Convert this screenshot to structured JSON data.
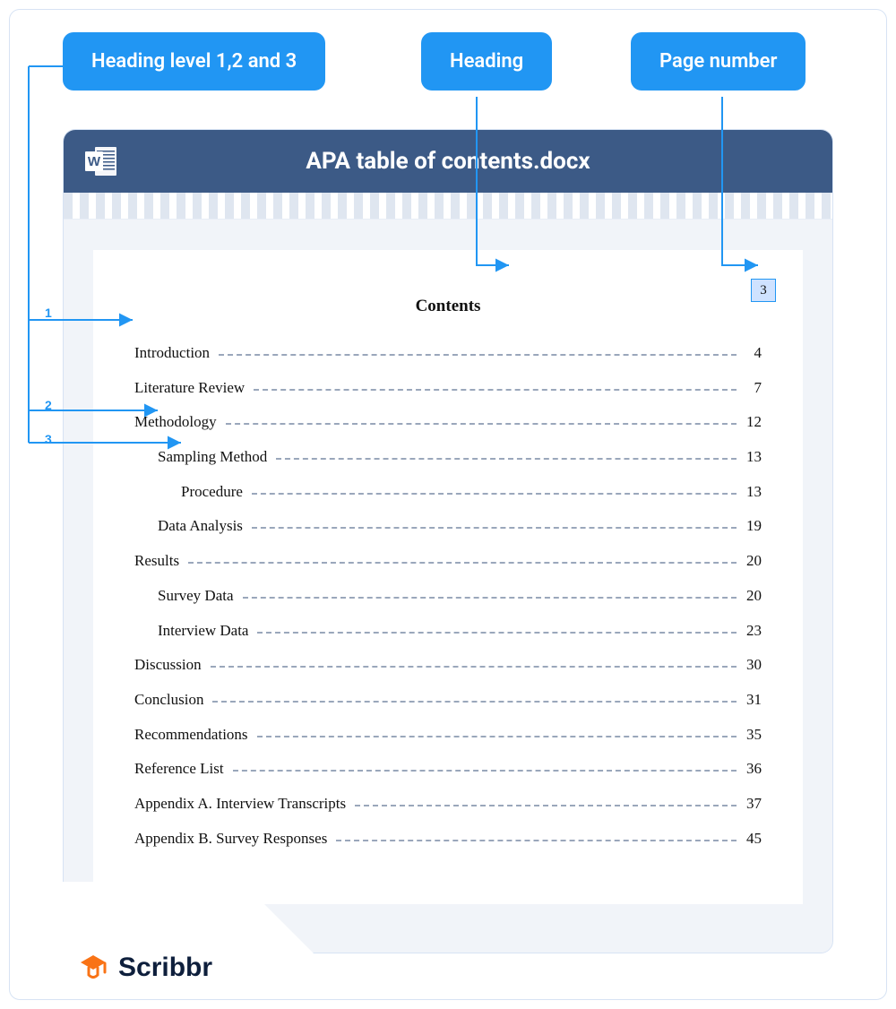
{
  "callouts": {
    "levels": "Heading level 1,2 and 3",
    "heading": "Heading",
    "page_number": "Page number"
  },
  "level_markers": {
    "n1": "1",
    "n2": "2",
    "n3": "3"
  },
  "document": {
    "filename": "APA table of contents.docx",
    "page_number_shown": "3",
    "contents_title": "Contents"
  },
  "toc_entries": [
    {
      "label": "Introduction",
      "page": "4",
      "level": 1
    },
    {
      "label": "Literature Review",
      "page": "7",
      "level": 1
    },
    {
      "label": "Methodology",
      "page": "12",
      "level": 1
    },
    {
      "label": "Sampling Method",
      "page": "13",
      "level": 2
    },
    {
      "label": "Procedure",
      "page": "13",
      "level": 3
    },
    {
      "label": "Data Analysis",
      "page": "19",
      "level": 2
    },
    {
      "label": "Results",
      "page": "20",
      "level": 1
    },
    {
      "label": "Survey Data",
      "page": "20",
      "level": 2
    },
    {
      "label": "Interview Data",
      "page": "23",
      "level": 2
    },
    {
      "label": "Discussion",
      "page": "30",
      "level": 1
    },
    {
      "label": "Conclusion",
      "page": "31",
      "level": 1
    },
    {
      "label": "Recommendations",
      "page": "35",
      "level": 1
    },
    {
      "label": "Reference List",
      "page": "36",
      "level": 1
    },
    {
      "label": "Appendix A. Interview Transcripts",
      "page": "37",
      "level": 1
    },
    {
      "label": "Appendix B. Survey Responses",
      "page": "45",
      "level": 1
    }
  ],
  "brand": {
    "name": "Scribbr"
  },
  "colors": {
    "callout_blue": "#2196f3",
    "titlebar": "#3c5a86",
    "brand_orange": "#f97316",
    "frame_border": "#d7e3f4"
  }
}
